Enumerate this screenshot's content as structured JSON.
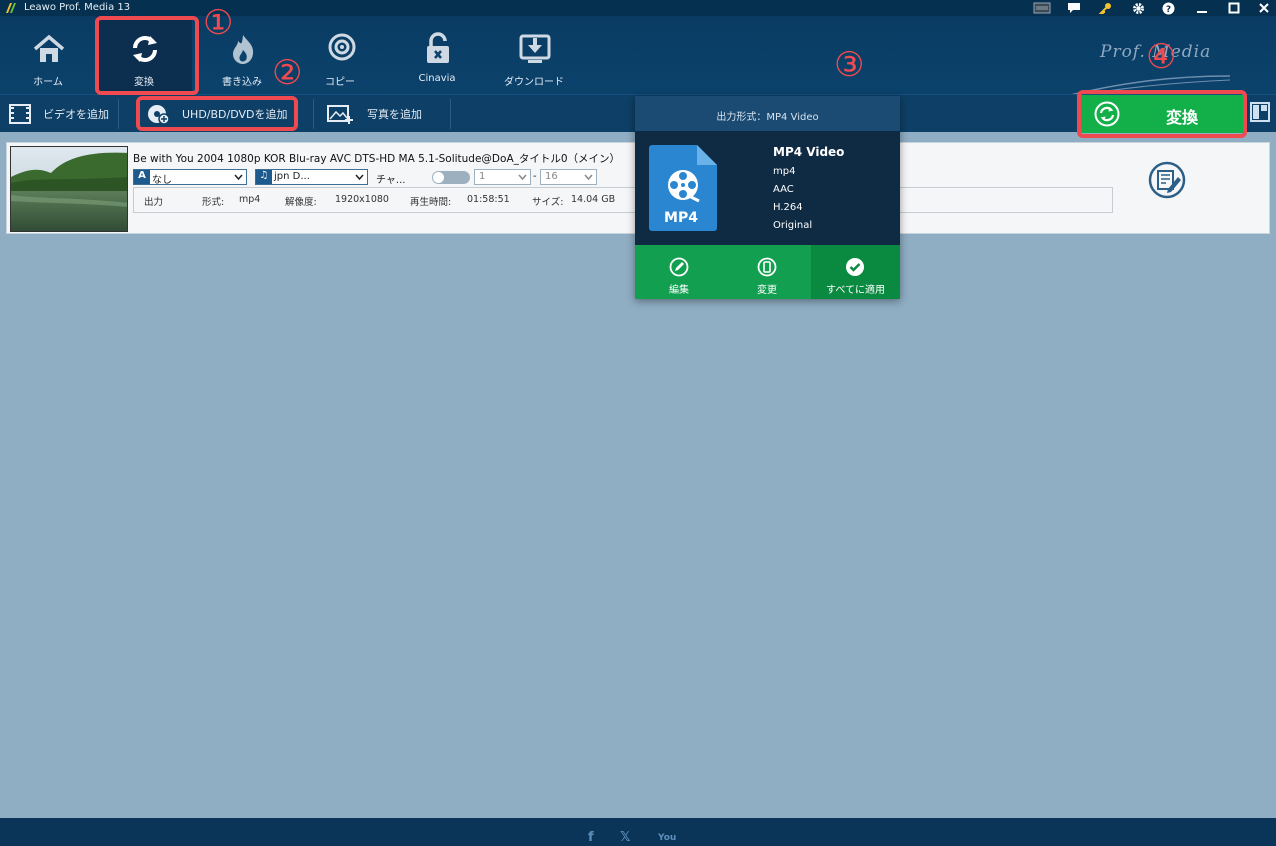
{
  "app": {
    "title": "Leawo Prof. Media 13"
  },
  "window_icons": [
    "amd-icon",
    "chat-icon",
    "key-icon",
    "gear-icon",
    "help-icon",
    "minimize-icon",
    "maximize-icon",
    "close-icon"
  ],
  "nav": {
    "items": [
      {
        "label": "ホーム",
        "icon": "home-icon"
      },
      {
        "label": "変換",
        "icon": "convert-icon",
        "active": true
      },
      {
        "label": "書き込み",
        "icon": "burn-icon"
      },
      {
        "label": "コピー",
        "icon": "copy-icon"
      },
      {
        "label": "Cinavia",
        "icon": "cinavia-icon"
      },
      {
        "label": "ダウンロード",
        "icon": "download-icon"
      }
    ],
    "brand": "Prof. Media"
  },
  "toolbar": {
    "add_video": "ビデオを追加",
    "add_disc": "UHD/BD/DVDを追加",
    "add_photo": "写真を追加"
  },
  "file": {
    "title": "Be with You 2004 1080p KOR Blu-ray AVC DTS-HD MA 5.1-Solitude@DoA_タイトル0（メイン）",
    "subtitle_tag": "A",
    "subtitle_value": "なし",
    "audio_value": "jpn D...",
    "chapter_label": "チャ...",
    "chapter_start": "1",
    "chapter_sep": "-",
    "chapter_end": "16",
    "info": {
      "output_label": "出力",
      "format_label": "形式:",
      "format_value": "mp4",
      "resolution_label": "解像度:",
      "resolution_value": "1920x1080",
      "duration_label": "再生時間:",
      "duration_value": "01:58:51",
      "size_label": "サイズ:",
      "size_value": "14.04 GB"
    }
  },
  "popup": {
    "header": "出力形式：MP4 Video",
    "format_name": "MP4 Video",
    "file_badge": "MP4",
    "lines": [
      "mp4",
      "AAC",
      "H.264",
      "Original"
    ],
    "buttons": [
      "編集",
      "変更",
      "すべてに適用"
    ]
  },
  "convert_button": {
    "label": "変換"
  },
  "annotations": [
    "①",
    "②",
    "③",
    "④"
  ],
  "social": [
    "f",
    "𝕏",
    "You"
  ],
  "colors": {
    "header_bg": "#0a3c63",
    "content_bg": "#8fadc3",
    "accent_green": "#13b04a",
    "annotation_red": "#ef4a4f"
  }
}
